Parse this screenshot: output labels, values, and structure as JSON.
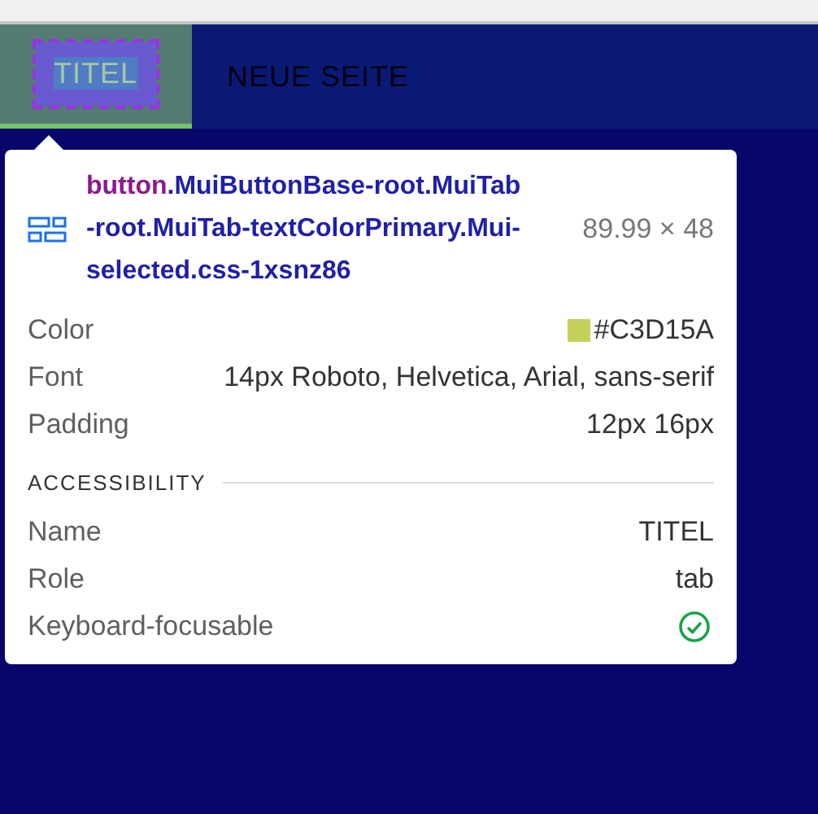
{
  "tabs": [
    {
      "label": "TITEL",
      "selected": true
    },
    {
      "label": "NEUE SEITE",
      "selected": false
    }
  ],
  "inspector": {
    "tag": "button",
    "selector": ".MuiButtonBase-root.MuiTab-root.MuiTab-textColorPrimary.Mui-selected.css-1xsnz86",
    "size": "89.99 × 48",
    "properties": [
      {
        "kind": "color",
        "label": "Color",
        "value": "#C3D15A",
        "color": "#c3d15a"
      },
      {
        "kind": "text",
        "label": "Font",
        "value": "14px Roboto, Helvetica, Arial, sans-serif"
      },
      {
        "kind": "text",
        "label": "Padding",
        "value": "12px 16px"
      }
    ],
    "section": "ACCESSIBILITY",
    "accessibility": [
      {
        "kind": "text",
        "label": "Name",
        "value": "TITEL"
      },
      {
        "kind": "text",
        "label": "Role",
        "value": "tab"
      },
      {
        "kind": "check",
        "label": "Keyboard-focusable",
        "checked": true
      }
    ]
  }
}
